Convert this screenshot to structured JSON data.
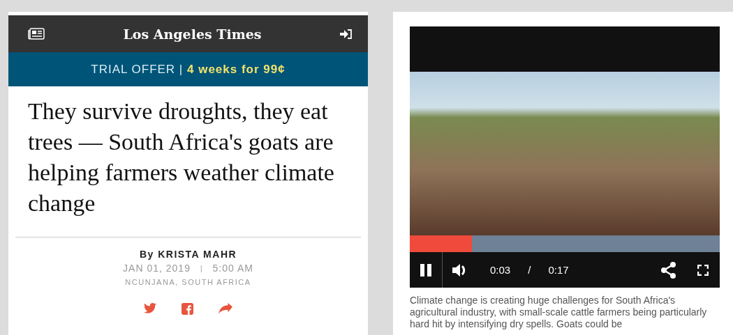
{
  "article": {
    "masthead": "Los Angeles Times",
    "promo": "TRIAL OFFER | **4 weeks for 99¢**",
    "headline": "They survive droughts, they eat trees — South Africa's goats are helping farmers weather climate change",
    "byline": "By KRISTA MAHR",
    "date": "JAN 01, 2019",
    "separator": "|",
    "time": "5:00 AM",
    "location": "NCUNJANA, SOUTH AFRICA"
  },
  "video": {
    "playing": true,
    "level": 0.2,
    "current_time": "0:03",
    "time_separator": "/",
    "duration": "0:17",
    "caption": "Climate change is creating huge challenges for South Africa's agricultural industry, with small-scale cattle farmers being particularly hard hit by intensifying dry spells. Goats could be"
  }
}
